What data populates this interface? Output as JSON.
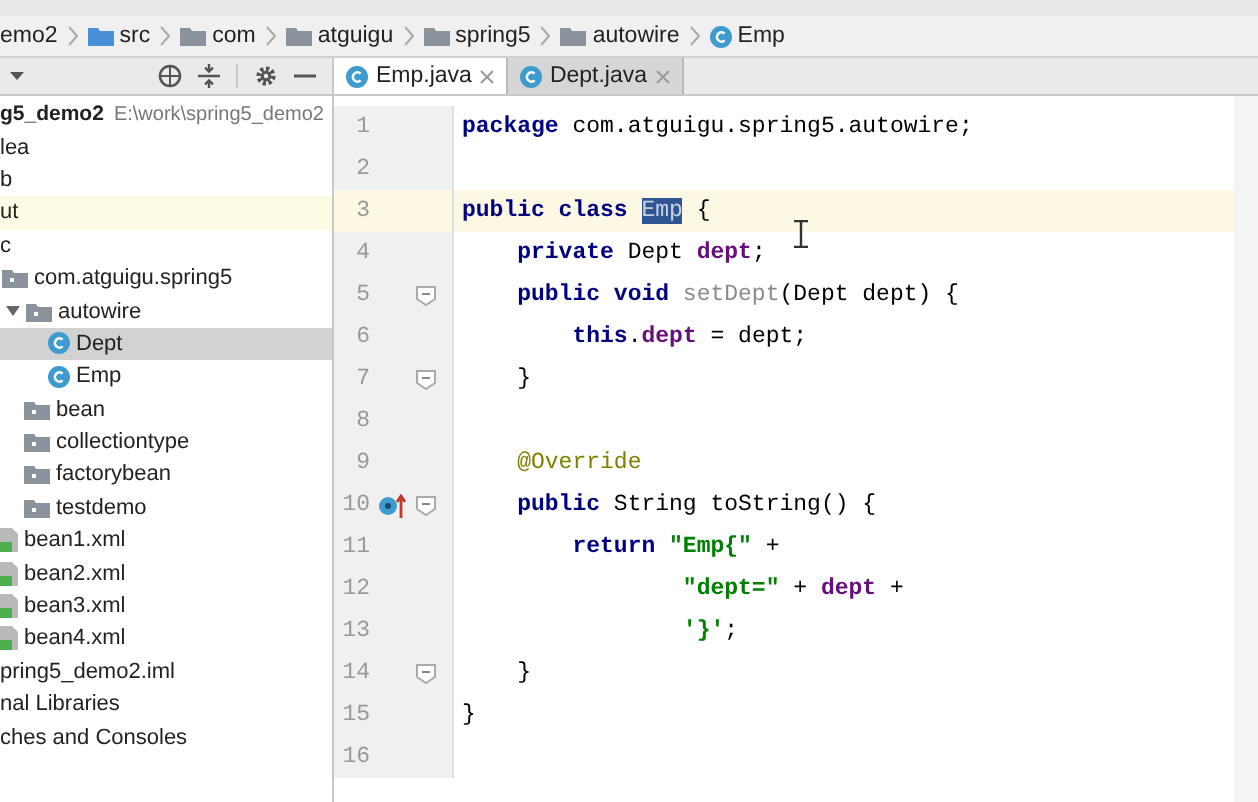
{
  "breadcrumb": [
    {
      "label": "emo2",
      "kind": "module"
    },
    {
      "label": "src",
      "kind": "source"
    },
    {
      "label": "com",
      "kind": "folder"
    },
    {
      "label": "atguigu",
      "kind": "folder"
    },
    {
      "label": "spring5",
      "kind": "folder"
    },
    {
      "label": "autowire",
      "kind": "folder"
    },
    {
      "label": "Emp",
      "kind": "class"
    }
  ],
  "tabs": [
    {
      "label": "Emp.java",
      "selected": true
    },
    {
      "label": "Dept.java",
      "selected": false
    }
  ],
  "tree": [
    {
      "label": "g5_demo2",
      "path": "E:\\work\\spring5_demo2",
      "kind": "module",
      "selected": false,
      "excluded": false,
      "children": [
        {
          "label": "lea",
          "selected": false,
          "excluded": false
        },
        {
          "label": "b",
          "selected": false,
          "excluded": false
        },
        {
          "label": "ut",
          "selected": false,
          "excluded": true
        },
        {
          "label": "c",
          "selected": false,
          "excluded": false,
          "children": [
            {
              "label": "com.atguigu.spring5",
              "kind": "package",
              "selected": false,
              "excluded": false,
              "children": [
                {
                  "label": "autowire",
                  "kind": "package",
                  "selected": false,
                  "excluded": false,
                  "children": [
                    {
                      "label": "Dept",
                      "kind": "class",
                      "selected": true,
                      "excluded": false
                    },
                    {
                      "label": "Emp",
                      "kind": "class",
                      "selected": false,
                      "excluded": false
                    }
                  ]
                },
                {
                  "label": "bean",
                  "kind": "package",
                  "selected": false,
                  "excluded": false
                },
                {
                  "label": "collectiontype",
                  "kind": "package",
                  "selected": false,
                  "excluded": false
                },
                {
                  "label": "factorybean",
                  "kind": "package",
                  "selected": false,
                  "excluded": false
                },
                {
                  "label": "testdemo",
                  "kind": "package",
                  "selected": false,
                  "excluded": false
                }
              ]
            },
            {
              "label": "bean1.xml",
              "kind": "xml",
              "selected": false,
              "excluded": false
            },
            {
              "label": "bean2.xml",
              "kind": "xml",
              "selected": false,
              "excluded": false
            },
            {
              "label": "bean3.xml",
              "kind": "xml",
              "selected": false,
              "excluded": false
            },
            {
              "label": "bean4.xml",
              "kind": "xml",
              "selected": false,
              "excluded": false
            }
          ]
        },
        {
          "label": "pring5_demo2.iml",
          "selected": false,
          "excluded": false
        }
      ]
    },
    {
      "label": "nal Libraries",
      "selected": false,
      "excluded": false
    },
    {
      "label": "ches and Consoles",
      "selected": false,
      "excluded": false
    }
  ],
  "lines": [
    {
      "number": "1",
      "current": false,
      "fold": false,
      "override": false,
      "tokens": [
        {
          "text": "package ",
          "kind": "keyword"
        },
        {
          "text": "com.atguigu.spring5.autowire;",
          "kind": "plain"
        }
      ]
    },
    {
      "number": "2",
      "current": false,
      "fold": false,
      "override": false
    },
    {
      "number": "3",
      "current": true,
      "fold": false,
      "override": false,
      "tokens": [
        {
          "text": "public class ",
          "kind": "keyword"
        },
        {
          "text": "Emp",
          "kind": "selection"
        },
        {
          "text": " {",
          "kind": "plain"
        }
      ]
    },
    {
      "number": "4",
      "current": false,
      "fold": false,
      "override": false,
      "tokens": [
        {
          "text": "    private ",
          "kind": "keyword"
        },
        {
          "text": "Dept ",
          "kind": "plain"
        },
        {
          "text": "dept",
          "kind": "field"
        },
        {
          "text": ";",
          "kind": "plain"
        }
      ]
    },
    {
      "number": "5",
      "current": false,
      "fold": true,
      "override": false,
      "tokens": [
        {
          "text": "    public void ",
          "kind": "keyword"
        },
        {
          "text": "setDept",
          "kind": "unused"
        },
        {
          "text": "(Dept dept) {",
          "kind": "plain"
        }
      ]
    },
    {
      "number": "6",
      "current": false,
      "fold": false,
      "override": false,
      "tokens": [
        {
          "text": "        this",
          "kind": "keyword"
        },
        {
          "text": ".",
          "kind": "plain"
        },
        {
          "text": "dept",
          "kind": "field"
        },
        {
          "text": " = dept;",
          "kind": "plain"
        }
      ]
    },
    {
      "number": "7",
      "current": false,
      "fold": true,
      "override": false,
      "tokens": [
        {
          "text": "    }",
          "kind": "plain"
        }
      ]
    },
    {
      "number": "8",
      "current": false,
      "fold": false,
      "override": false
    },
    {
      "number": "9",
      "current": false,
      "fold": false,
      "override": false,
      "tokens": [
        {
          "text": "    @Override",
          "kind": "annotation"
        }
      ]
    },
    {
      "number": "10",
      "current": false,
      "fold": true,
      "override": true,
      "tokens": [
        {
          "text": "    public ",
          "kind": "keyword"
        },
        {
          "text": "String toString() {",
          "kind": "plain"
        }
      ]
    },
    {
      "number": "11",
      "current": false,
      "fold": false,
      "override": false,
      "tokens": [
        {
          "text": "        return ",
          "kind": "keyword"
        },
        {
          "text": "\"Emp{\"",
          "kind": "string"
        },
        {
          "text": " +",
          "kind": "plain"
        }
      ]
    },
    {
      "number": "12",
      "current": false,
      "fold": false,
      "override": false,
      "tokens": [
        {
          "text": "                \"dept=\"",
          "kind": "string"
        },
        {
          "text": " + ",
          "kind": "plain"
        },
        {
          "text": "dept",
          "kind": "field"
        },
        {
          "text": " +",
          "kind": "plain"
        }
      ]
    },
    {
      "number": "13",
      "current": false,
      "fold": false,
      "override": false,
      "tokens": [
        {
          "text": "                '}'",
          "kind": "string"
        },
        {
          "text": ";",
          "kind": "plain"
        }
      ]
    },
    {
      "number": "14",
      "current": false,
      "fold": true,
      "override": false,
      "tokens": [
        {
          "text": "    }",
          "kind": "plain"
        }
      ]
    },
    {
      "number": "15",
      "current": false,
      "fold": false,
      "override": false,
      "tokens": [
        {
          "text": "}",
          "kind": "plain"
        }
      ]
    },
    {
      "number": "16",
      "current": false,
      "fold": false,
      "override": false
    }
  ]
}
